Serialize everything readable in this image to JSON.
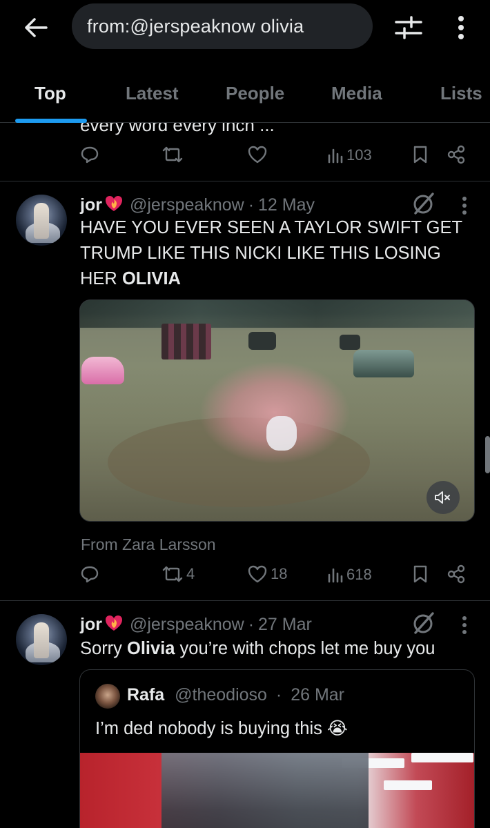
{
  "search": {
    "query": "from:@jerspeaknow olivia"
  },
  "tabs": [
    {
      "label": "Top",
      "active": true
    },
    {
      "label": "Latest",
      "active": false
    },
    {
      "label": "People",
      "active": false
    },
    {
      "label": "Media",
      "active": false
    },
    {
      "label": "Lists",
      "active": false
    }
  ],
  "partial_tweet": {
    "text": "every word every inch ...",
    "actions": {
      "reply": "",
      "retweet": "",
      "like": "",
      "views": "103"
    }
  },
  "tweets": [
    {
      "name": "jor",
      "handle": "@jerspeaknow",
      "time": "12 May",
      "text_plain": "HAVE YOU EVER SEEN A TAYLOR SWIFT GET TRUMP LIKE THIS NICKI LIKE THIS LOSING HER ",
      "text_bold": "OLIVIA",
      "source_label": "From Zara Larsson",
      "actions": {
        "reply": "",
        "retweet": "4",
        "like": "18",
        "views": "618"
      }
    },
    {
      "name": "jor",
      "handle": "@jerspeaknow",
      "time": "27 Mar",
      "text_before": "Sorry ",
      "text_bold": "Olivia",
      "text_after": " you’re with chops let me buy you",
      "quote": {
        "name": "Rafa",
        "handle": "@theodioso",
        "time": "26 Mar",
        "text": "I’m ded nobody is buying this 😭"
      }
    }
  ],
  "colors": {
    "accent": "#1d9bf0",
    "muted": "#71767b",
    "text": "#e7e9ea",
    "border": "#2f3336"
  }
}
